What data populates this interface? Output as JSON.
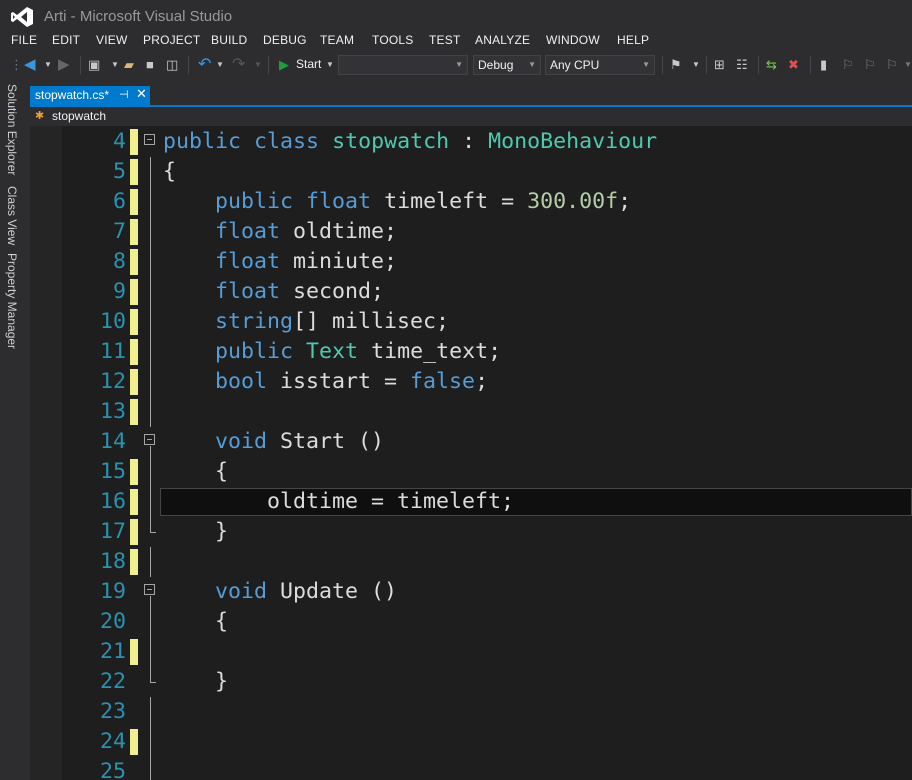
{
  "window": {
    "title": "Arti - Microsoft Visual Studio"
  },
  "menu": [
    "FILE",
    "EDIT",
    "VIEW",
    "PROJECT",
    "BUILD",
    "DEBUG",
    "TEAM",
    "TOOLS",
    "TEST",
    "ANALYZE",
    "WINDOW",
    "HELP"
  ],
  "toolbar": {
    "start_label": "Start",
    "config_value": "Debug",
    "platform_value": "Any CPU",
    "target_value": ""
  },
  "side_tabs": [
    "Solution Explorer",
    "Class View",
    "Property Manager"
  ],
  "document_tab": {
    "label": "stopwatch.cs*"
  },
  "navigation": {
    "class_label": "stopwatch"
  },
  "colors": {
    "accent": "#007acc",
    "keyword": "#569cd6",
    "type": "#4ec9b0",
    "number": "#b5cea8",
    "line_number": "#2b91af",
    "change_marker": "#efef91"
  },
  "code_lines": [
    {
      "num": "4",
      "tokens": [
        [
          "kw",
          "public"
        ],
        [
          "t",
          " "
        ],
        [
          "kw",
          "class"
        ],
        [
          "t",
          " "
        ],
        [
          "ty",
          "stopwatch"
        ],
        [
          "t",
          " : "
        ],
        [
          "ty",
          "MonoBehaviour"
        ]
      ],
      "changed": true,
      "fold": "open"
    },
    {
      "num": "5",
      "tokens": [
        [
          "t",
          "{"
        ]
      ],
      "changed": true,
      "fold": "line"
    },
    {
      "num": "6",
      "tokens": [
        [
          "t",
          "    "
        ],
        [
          "kw",
          "public"
        ],
        [
          "t",
          " "
        ],
        [
          "kw",
          "float"
        ],
        [
          "t",
          " timeleft = "
        ],
        [
          "num",
          "300.00f"
        ],
        [
          "t",
          ";"
        ]
      ],
      "changed": true,
      "fold": "line"
    },
    {
      "num": "7",
      "tokens": [
        [
          "t",
          "    "
        ],
        [
          "kw",
          "float"
        ],
        [
          "t",
          " oldtime;"
        ]
      ],
      "changed": true,
      "fold": "line"
    },
    {
      "num": "8",
      "tokens": [
        [
          "t",
          "    "
        ],
        [
          "kw",
          "float"
        ],
        [
          "t",
          " miniute;"
        ]
      ],
      "changed": true,
      "fold": "line"
    },
    {
      "num": "9",
      "tokens": [
        [
          "t",
          "    "
        ],
        [
          "kw",
          "float"
        ],
        [
          "t",
          " second;"
        ]
      ],
      "changed": true,
      "fold": "line"
    },
    {
      "num": "10",
      "tokens": [
        [
          "t",
          "    "
        ],
        [
          "kw",
          "string"
        ],
        [
          "t",
          "[] millisec;"
        ]
      ],
      "changed": true,
      "fold": "line"
    },
    {
      "num": "11",
      "tokens": [
        [
          "t",
          "    "
        ],
        [
          "kw",
          "public"
        ],
        [
          "t",
          " "
        ],
        [
          "ty",
          "Text"
        ],
        [
          "t",
          " time_text;"
        ]
      ],
      "changed": true,
      "fold": "line"
    },
    {
      "num": "12",
      "tokens": [
        [
          "t",
          "    "
        ],
        [
          "kw",
          "bool"
        ],
        [
          "t",
          " isstart = "
        ],
        [
          "kw",
          "false"
        ],
        [
          "t",
          ";"
        ]
      ],
      "changed": true,
      "fold": "line"
    },
    {
      "num": "13",
      "tokens": [],
      "changed": true,
      "fold": "line"
    },
    {
      "num": "14",
      "tokens": [
        [
          "t",
          "    "
        ],
        [
          "kw",
          "void"
        ],
        [
          "t",
          " Start ()"
        ]
      ],
      "changed": false,
      "fold": "open"
    },
    {
      "num": "15",
      "tokens": [
        [
          "t",
          "    {"
        ]
      ],
      "changed": true,
      "fold": "line"
    },
    {
      "num": "16",
      "tokens": [
        [
          "t",
          "        oldtime = timeleft;"
        ]
      ],
      "changed": true,
      "fold": "line",
      "current": true
    },
    {
      "num": "17",
      "tokens": [
        [
          "t",
          "    }"
        ]
      ],
      "changed": true,
      "fold": "end"
    },
    {
      "num": "18",
      "tokens": [],
      "changed": true,
      "fold": "line"
    },
    {
      "num": "19",
      "tokens": [
        [
          "t",
          "    "
        ],
        [
          "kw",
          "void"
        ],
        [
          "t",
          " Update ()"
        ]
      ],
      "changed": false,
      "fold": "open"
    },
    {
      "num": "20",
      "tokens": [
        [
          "t",
          "    {"
        ]
      ],
      "changed": false,
      "fold": "line"
    },
    {
      "num": "21",
      "tokens": [],
      "changed": true,
      "fold": "line"
    },
    {
      "num": "22",
      "tokens": [
        [
          "t",
          "    }"
        ]
      ],
      "changed": false,
      "fold": "end"
    },
    {
      "num": "23",
      "tokens": [],
      "changed": false,
      "fold": "line"
    },
    {
      "num": "24",
      "tokens": [],
      "changed": true,
      "fold": "line"
    },
    {
      "num": "25",
      "tokens": [],
      "changed": false,
      "fold": "line"
    }
  ]
}
